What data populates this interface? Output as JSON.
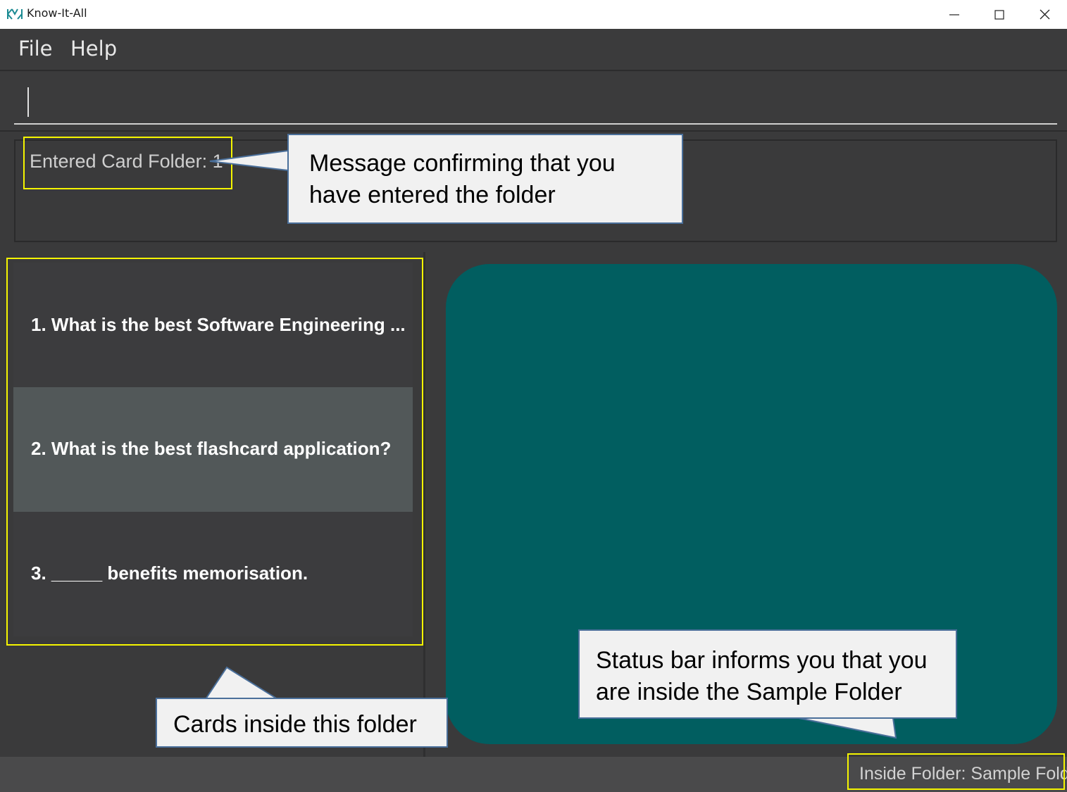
{
  "window": {
    "title": "Know-It-All",
    "controls": {
      "minimize": "minimize-icon",
      "maximize": "maximize-icon",
      "close": "close-icon"
    }
  },
  "menu": {
    "file": "File",
    "help": "Help"
  },
  "command_box": {
    "value": "",
    "placeholder": ""
  },
  "result_display": {
    "text": "Entered Card Folder: 1"
  },
  "card_list": [
    {
      "text": "1.  What is the best Software Engineering ..."
    },
    {
      "text": "2.  What is the best flashcard application?"
    },
    {
      "text": "3.  _____ benefits memorisation."
    }
  ],
  "status_bar": {
    "text": "Inside Folder: Sample Folder"
  },
  "annotations": {
    "message": {
      "line1": "Message confirming that you",
      "line2": "have entered the folder"
    },
    "cards": {
      "text": "Cards inside this folder"
    },
    "status": {
      "line1": "Status bar informs you that you",
      "line2": "are inside the Sample Folder"
    }
  },
  "colors": {
    "app_background": "#3a3a3b",
    "selected_row": "#525859",
    "card_display": "#015e60",
    "status_bar": "#4a4a4b",
    "highlight": "#f5f500",
    "callout_border": "#4a6f9a",
    "callout_fill": "#f1f1f1"
  }
}
